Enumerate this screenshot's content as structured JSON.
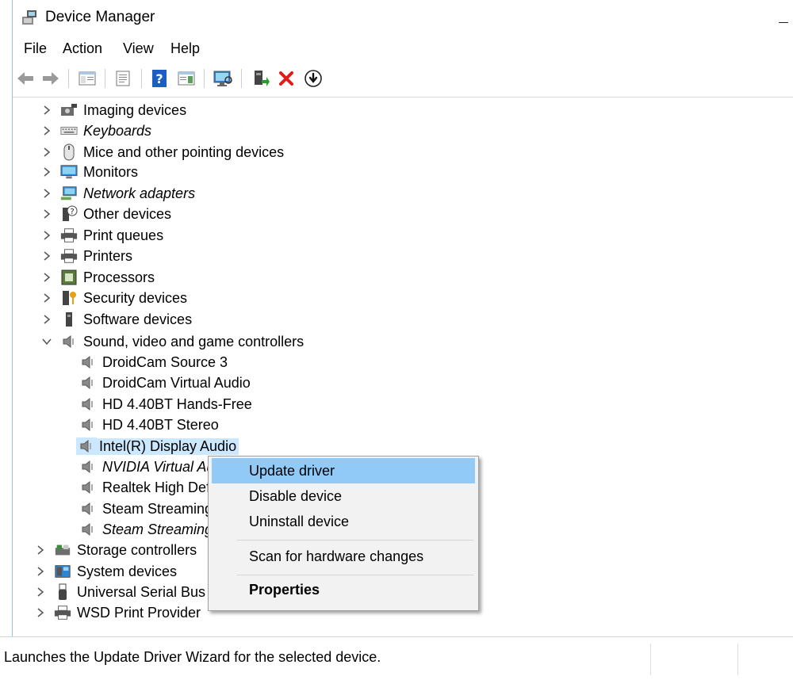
{
  "window": {
    "title": "Device Manager"
  },
  "menu": [
    "File",
    "Action",
    "View",
    "Help"
  ],
  "toolbar": {
    "back": "back-arrow-icon",
    "forward": "forward-arrow-icon",
    "show_hide": "console-tree-icon",
    "properties": "properties-sheet-icon",
    "help": "help-icon",
    "action_pane": "action-pane-icon",
    "scan": "monitor-scan-icon",
    "update_driver": "update-driver-icon",
    "uninstall": "red-x-icon",
    "disable": "download-circle-icon"
  },
  "tree": {
    "categories": [
      {
        "label": "Imaging devices",
        "italic": false,
        "icon": "camera-icon"
      },
      {
        "label": "Keyboards",
        "italic": true,
        "icon": "keyboard-icon"
      },
      {
        "label": "Mice and other pointing devices",
        "italic": false,
        "icon": "mouse-icon"
      },
      {
        "label": "Monitors",
        "italic": false,
        "icon": "monitor-icon"
      },
      {
        "label": "Network adapters",
        "italic": true,
        "icon": "network-adapter-icon"
      },
      {
        "label": "Other devices",
        "italic": false,
        "icon": "unknown-device-icon"
      },
      {
        "label": "Print queues",
        "italic": false,
        "icon": "printer-icon"
      },
      {
        "label": "Printers",
        "italic": false,
        "icon": "printer-icon"
      },
      {
        "label": "Processors",
        "italic": false,
        "icon": "processor-icon"
      },
      {
        "label": "Security devices",
        "italic": false,
        "icon": "security-key-icon"
      },
      {
        "label": "Software devices",
        "italic": false,
        "icon": "software-device-icon"
      },
      {
        "label": "Sound, video and game controllers",
        "italic": false,
        "icon": "speaker-icon"
      }
    ],
    "sound_children": [
      {
        "label": "DroidCam Source 3",
        "italic": false
      },
      {
        "label": "DroidCam Virtual Audio",
        "italic": false
      },
      {
        "label": "HD 4.40BT Hands-Free",
        "italic": false
      },
      {
        "label": "HD 4.40BT Stereo",
        "italic": false
      },
      {
        "label": "Intel(R) Display Audio",
        "italic": false,
        "selected": true
      },
      {
        "label": "NVIDIA Virtual Au",
        "italic": true
      },
      {
        "label": "Realtek High Defi",
        "italic": false
      },
      {
        "label": "Steam Streaming",
        "italic": false
      },
      {
        "label": "Steam Streaming",
        "italic": true
      }
    ],
    "after": [
      {
        "label": "Storage controllers",
        "italic": false,
        "icon": "storage-controller-icon"
      },
      {
        "label": "System devices",
        "italic": false,
        "icon": "system-devices-icon"
      },
      {
        "label": "Universal Serial Bus c",
        "italic": false,
        "icon": "usb-icon"
      },
      {
        "label": "WSD Print Provider",
        "italic": false,
        "icon": "printer-icon"
      }
    ]
  },
  "context_menu": {
    "update": "Update driver",
    "disable": "Disable device",
    "uninstall": "Uninstall device",
    "scan": "Scan for hardware changes",
    "properties": "Properties"
  },
  "status": {
    "text": "Launches the Update Driver Wizard for the selected device."
  }
}
